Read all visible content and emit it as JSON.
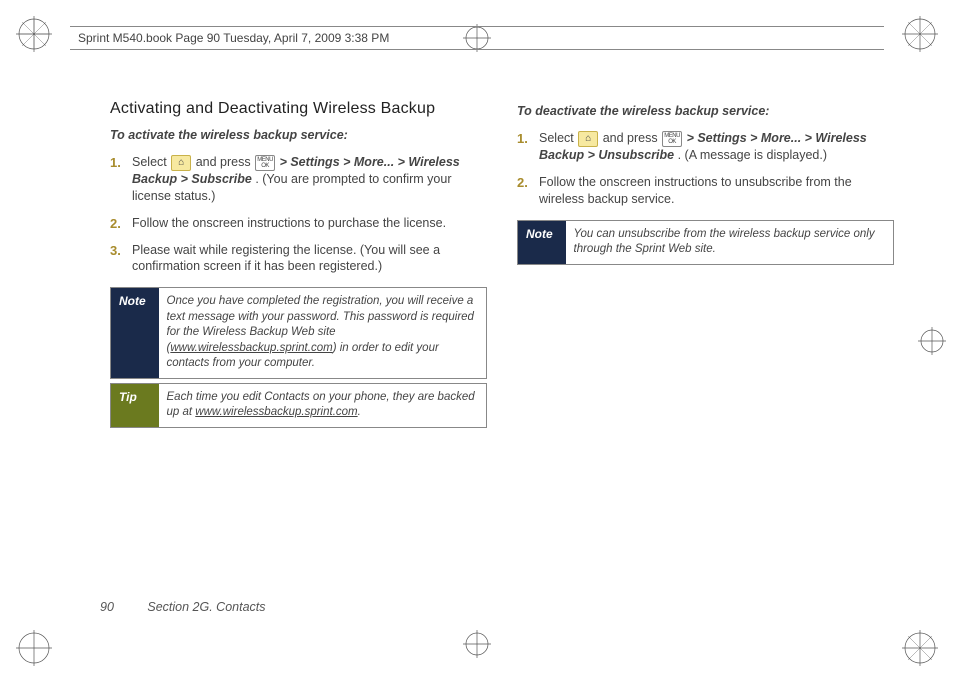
{
  "header": {
    "running": "Sprint M540.book  Page 90  Tuesday, April 7, 2009  3:38 PM"
  },
  "left": {
    "title": "Activating and Deactivating Wireless Backup",
    "subhead": "To activate the wireless backup service:",
    "steps": [
      {
        "n": "1.",
        "pre": "Select ",
        "key1": "⌂",
        "mid1": " and press ",
        "key2": "MENU OK",
        "path": " > Settings > More... > Wireless Backup > Subscribe",
        "post": ". (You are prompted to confirm your license status.)"
      },
      {
        "n": "2.",
        "text": "Follow the onscreen instructions to purchase the license."
      },
      {
        "n": "3.",
        "text": "Please wait while registering the license. (You will see a confirmation screen if it has been registered.)"
      }
    ],
    "note": {
      "label": "Note",
      "body_pre": "Once you have completed the registration, you will receive a text message with your password. This password is required for the Wireless Backup Web site (",
      "url": "www.wirelessbackup.sprint.com",
      "body_post": ") in order to edit your contacts from your computer."
    },
    "tip": {
      "label": "Tip",
      "body_pre": "Each time you edit Contacts on your phone, they are backed up at ",
      "url": "www.wirelessbackup.sprint.com",
      "body_post": "."
    }
  },
  "right": {
    "subhead": "To deactivate the wireless backup service:",
    "steps": [
      {
        "n": "1.",
        "pre": "Select ",
        "key1": "⌂",
        "mid1": " and press ",
        "key2": "MENU OK",
        "path": " > Settings > More... > Wireless Backup > Unsubscribe",
        "post": ". (A message is displayed.)"
      },
      {
        "n": "2.",
        "text": "Follow the onscreen instructions to unsubscribe from the wireless backup service."
      }
    ],
    "note": {
      "label": "Note",
      "body": "You can unsubscribe from the wireless backup service only through the Sprint Web site."
    }
  },
  "footer": {
    "page": "90",
    "section": "Section 2G. Contacts"
  }
}
